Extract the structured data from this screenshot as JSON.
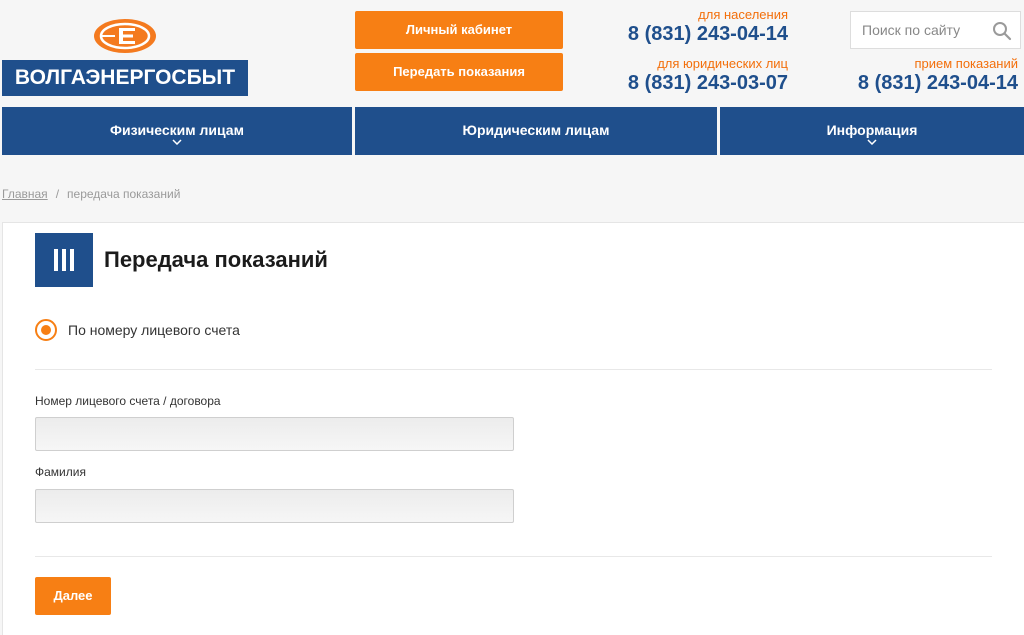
{
  "brand": {
    "name": "ВОЛГАЭНЕРГОСБЫТ",
    "colors": {
      "primary": "#1f4f8c",
      "accent": "#f77f14"
    }
  },
  "header": {
    "buttons": {
      "cabinet": "Личный кабинет",
      "submit_readings": "Передать показания"
    },
    "phones": [
      {
        "caption": "для населения",
        "number": "8 (831) 243-04-14"
      },
      {
        "caption": "для юридических лиц",
        "number": "8 (831) 243-03-07"
      },
      {
        "caption": "прием показаний",
        "number": "8 (831) 243-04-14"
      }
    ],
    "search": {
      "placeholder": "Поиск по сайту",
      "icon": "search-icon"
    }
  },
  "nav": {
    "items": [
      {
        "label": "Физическим лицам",
        "has_dropdown": true
      },
      {
        "label": "Юридическим лицам",
        "has_dropdown": false
      },
      {
        "label": "Информация",
        "has_dropdown": true
      }
    ]
  },
  "breadcrumb": {
    "home": "Главная",
    "separator": "/",
    "current": "передача показаний"
  },
  "main": {
    "title": "Передача показаний",
    "radio": {
      "label": "По номеру лицевого счета",
      "checked": true
    },
    "fields": {
      "account": {
        "label": "Номер лицевого счета / договора",
        "value": ""
      },
      "surname": {
        "label": "Фамилия",
        "value": ""
      }
    },
    "submit_label": "Далее"
  }
}
